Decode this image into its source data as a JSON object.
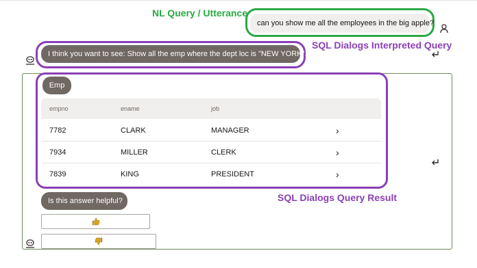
{
  "annotations": {
    "nl_query": "NL Query / Utterance",
    "interpreted": "SQL Dialogs Interpreted Query",
    "result": "SQL Dialogs Query Result"
  },
  "user_message": "can you show me all the employees in the big apple?",
  "bot_interpretation": "I think you want to see: Show all the emp where the dept loc is \"NEW YORK\".",
  "result": {
    "title": "Emp",
    "columns": [
      "empno",
      "ename",
      "job"
    ],
    "rows": [
      {
        "empno": "7782",
        "ename": "CLARK",
        "job": "MANAGER"
      },
      {
        "empno": "7934",
        "ename": "MILLER",
        "job": "CLERK"
      },
      {
        "empno": "7839",
        "ename": "KING",
        "job": "PRESIDENT"
      }
    ]
  },
  "feedback": {
    "question": "Is this answer helpful?"
  },
  "colors": {
    "green_annotation": "#2aa844",
    "purple_annotation": "#8a3fb5",
    "bot_bubble": "#6f6863",
    "thumb_up": "#e0a21a",
    "thumb_down": "#e0a21a"
  },
  "icons": [
    "user-icon",
    "bot-icon",
    "skill-icon",
    "chevron-right-icon",
    "thumbs-up-icon",
    "thumbs-down-icon"
  ]
}
